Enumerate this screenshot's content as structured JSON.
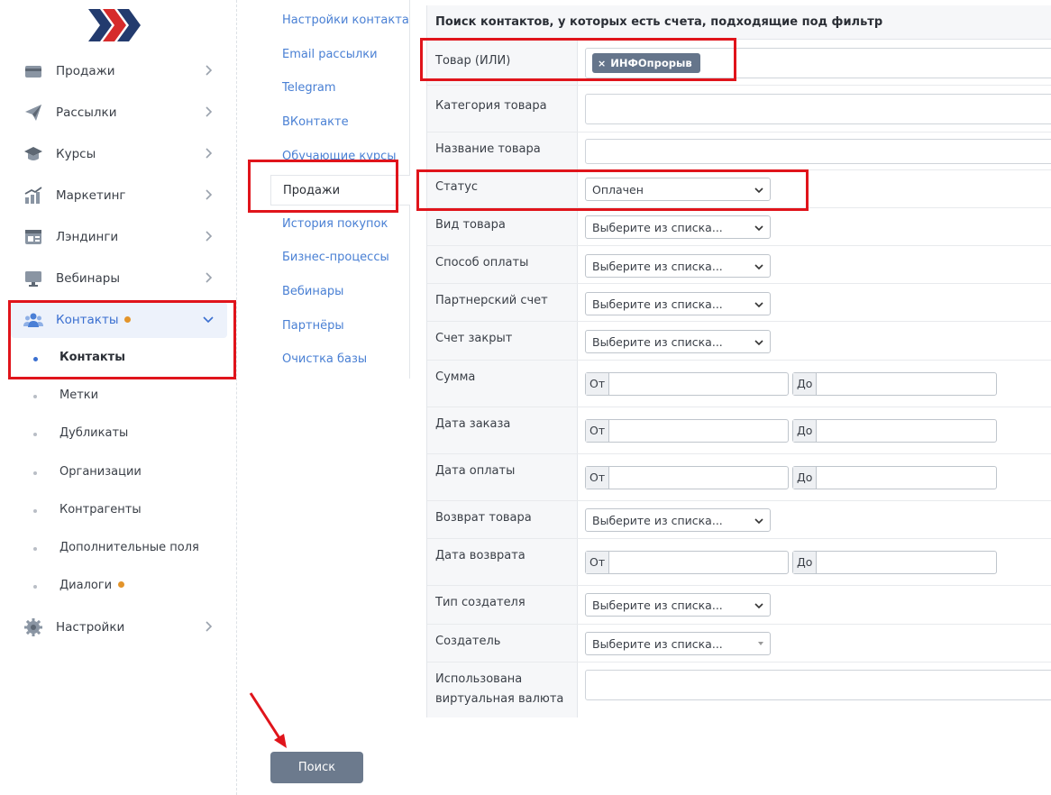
{
  "sidebar": {
    "items": [
      {
        "label": "Продажи",
        "icon": "cart-card-icon"
      },
      {
        "label": "Рассылки",
        "icon": "paper-plane-icon"
      },
      {
        "label": "Курсы",
        "icon": "graduation-cap-icon"
      },
      {
        "label": "Маркетинг",
        "icon": "bar-chart-icon"
      },
      {
        "label": "Лэндинги",
        "icon": "landing-page-icon"
      },
      {
        "label": "Вебинары",
        "icon": "monitor-icon"
      },
      {
        "label": "Контакты",
        "icon": "users-icon"
      },
      {
        "label": "Настройки",
        "icon": "gear-icon"
      }
    ],
    "contacts_sub": [
      {
        "label": "Контакты"
      },
      {
        "label": "Метки"
      },
      {
        "label": "Дубликаты"
      },
      {
        "label": "Организации"
      },
      {
        "label": "Контрагенты"
      },
      {
        "label": "Дополнительные поля"
      },
      {
        "label": "Диалоги"
      }
    ]
  },
  "submenu": {
    "items": [
      {
        "label": "Настройки контакта"
      },
      {
        "label": "Email рассылки"
      },
      {
        "label": "Telegram"
      },
      {
        "label": "ВКонтакте"
      },
      {
        "label": "Обучающие курсы"
      },
      {
        "label": "Продажи"
      },
      {
        "label": "История покупок"
      },
      {
        "label": "Бизнес-процессы"
      },
      {
        "label": "Вебинары"
      },
      {
        "label": "Партнёры"
      },
      {
        "label": "Очистка базы"
      }
    ]
  },
  "filter": {
    "title": "Поиск контактов, у которых есть счета, подходящие под фильтр",
    "placeholder_select": "Выберите из списка...",
    "from_label": "От",
    "to_label": "До",
    "rows": {
      "product": {
        "label": "Товар (ИЛИ)",
        "tag": "ИНФОпрорыв"
      },
      "category": {
        "label": "Категория товара"
      },
      "name": {
        "label": "Название товара"
      },
      "status": {
        "label": "Статус",
        "value": "Оплачен"
      },
      "type": {
        "label": "Вид товара"
      },
      "payment": {
        "label": "Способ оплаты"
      },
      "partner": {
        "label": "Партнерский счет"
      },
      "closed": {
        "label": "Счет закрыт"
      },
      "sum": {
        "label": "Сумма"
      },
      "order_date": {
        "label": "Дата заказа"
      },
      "pay_date": {
        "label": "Дата оплаты"
      },
      "refund": {
        "label": "Возврат товара"
      },
      "refund_date": {
        "label": "Дата возврата"
      },
      "creator_type": {
        "label": "Тип создателя"
      },
      "creator": {
        "label": "Создатель"
      },
      "virtual": {
        "label": "Использована виртуальная валюта"
      }
    }
  },
  "search_button": {
    "label": "Поиск"
  },
  "colors": {
    "accent": "#3a6fd0",
    "highlight": "#e0141b",
    "badge": "#e3942a",
    "button": "#6c7a8d"
  }
}
